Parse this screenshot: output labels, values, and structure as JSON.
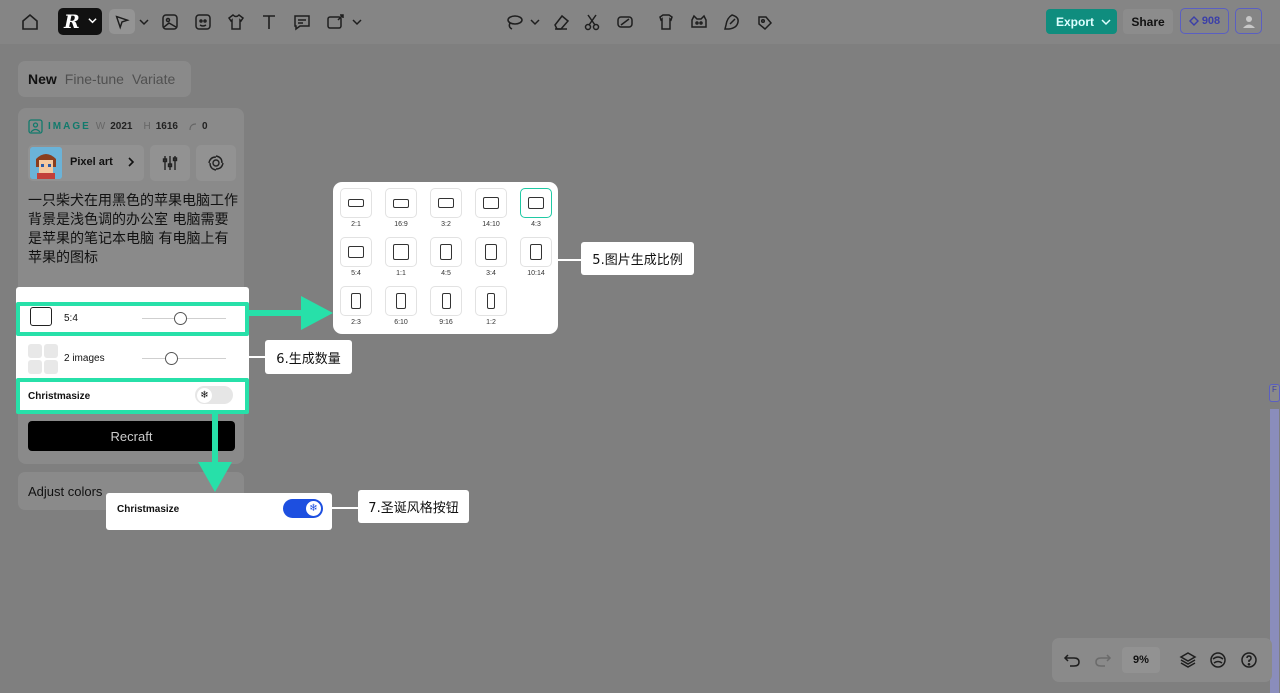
{
  "toolbar": {
    "logo_letter": "R",
    "export_label": "Export",
    "share_label": "Share",
    "credits": "908"
  },
  "left_panel": {
    "tabs": [
      {
        "label": "New",
        "active": true
      },
      {
        "label": "Fine-tune",
        "active": false
      },
      {
        "label": "Variate",
        "active": false
      }
    ],
    "meta": {
      "type_label": "IMAGE",
      "width_key": "W",
      "width_value": "2021",
      "height_key": "H",
      "height_value": "1616",
      "rotation_value": "0"
    },
    "style_name": "Pixel art",
    "prompt": "一只柴犬在用黑色的苹果电脑工作 背景是浅色调的办公室 电脑需要是苹果的笔记本电脑 有电脑上有苹果的图标",
    "adjust_colors_label": "Adjust colors"
  },
  "controls": {
    "ratio_label": "5:4",
    "ratio_slider": 0.45,
    "images_label": "2 images",
    "images_slider": 0.35,
    "christmasize_label": "Christmasize",
    "recraft_label": "Recraft"
  },
  "ratio_popup": {
    "options": [
      {
        "label": "2:1",
        "w": 2,
        "h": 1,
        "selected": false
      },
      {
        "label": "16:9",
        "w": 16,
        "h": 9,
        "selected": false
      },
      {
        "label": "3:2",
        "w": 3,
        "h": 2,
        "selected": false
      },
      {
        "label": "14:10",
        "w": 14,
        "h": 10,
        "selected": false
      },
      {
        "label": "4:3",
        "w": 4,
        "h": 3,
        "selected": true
      },
      {
        "label": "5:4",
        "w": 5,
        "h": 4,
        "selected": false
      },
      {
        "label": "1:1",
        "w": 1,
        "h": 1,
        "selected": false
      },
      {
        "label": "4:5",
        "w": 4,
        "h": 5,
        "selected": false
      },
      {
        "label": "3:4",
        "w": 3,
        "h": 4,
        "selected": false
      },
      {
        "label": "10:14",
        "w": 10,
        "h": 14,
        "selected": false
      },
      {
        "label": "2:3",
        "w": 2,
        "h": 3,
        "selected": false
      },
      {
        "label": "6:10",
        "w": 6,
        "h": 10,
        "selected": false
      },
      {
        "label": "9:16",
        "w": 9,
        "h": 16,
        "selected": false
      },
      {
        "label": "1:2",
        "w": 1,
        "h": 2,
        "selected": false
      }
    ]
  },
  "callouts": {
    "ratio_note": "5.图片生成比例",
    "count_note": "6.生成数量",
    "xmas_note": "7.圣诞风格按钮"
  },
  "xmas_popup": {
    "label": "Christmasize",
    "on": true
  },
  "side": {
    "tab_letter": "F"
  },
  "bottom_tools": {
    "zoom": "9%"
  },
  "colors": {
    "accent_green": "#27e0a9",
    "export_teal": "#0f8d7e",
    "toggle_blue": "#1d4fe0",
    "credits_purple": "#5a5fc2"
  }
}
